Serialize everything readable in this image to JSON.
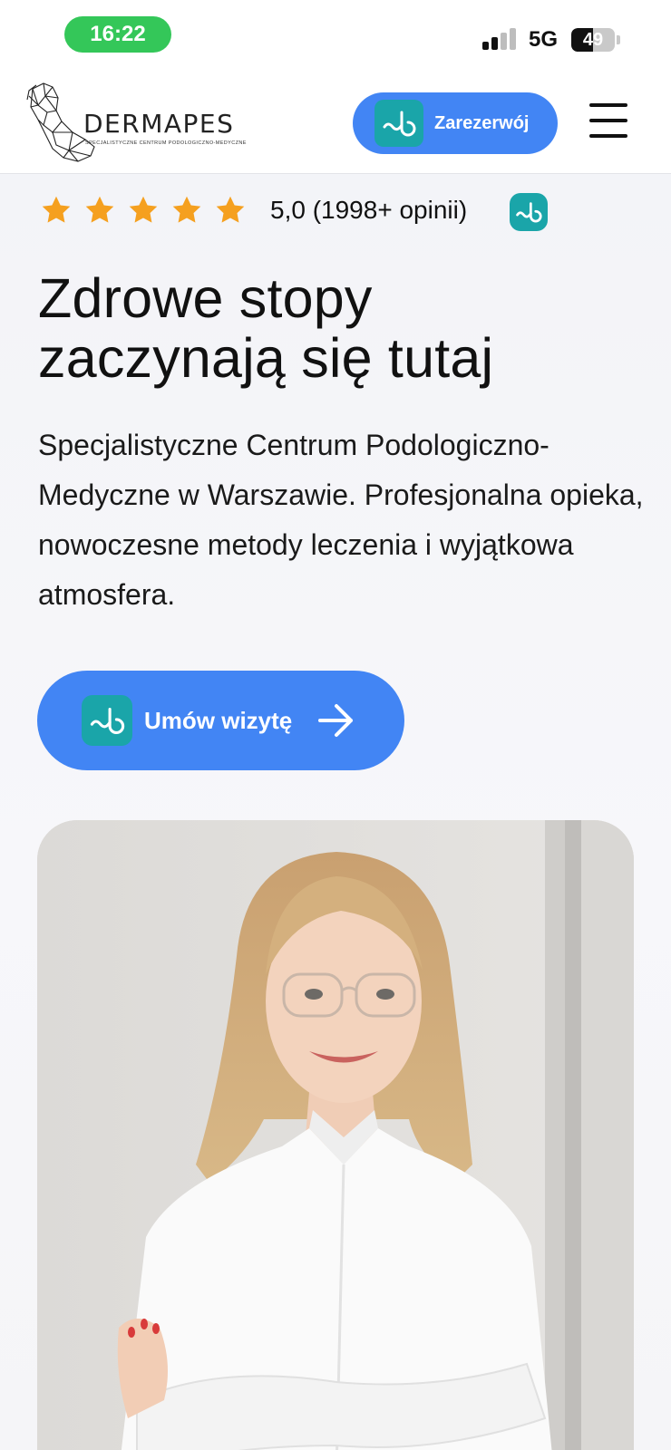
{
  "status_bar": {
    "time": "16:22",
    "network": "5G",
    "battery_level": "49",
    "battery_fraction": 0.49,
    "signal_bars_active": 2,
    "signal_bars_total": 4
  },
  "header": {
    "logo": {
      "name": "DERMAPES",
      "tagline": "SPECJALISTYCZNE CENTRUM PODOLOGICZNO-MEDYCZNE"
    },
    "reserve_button": {
      "label": "Zarezerwój",
      "icon": "booksy-icon"
    },
    "menu_icon": "hamburger-menu-icon"
  },
  "rating": {
    "stars": 5,
    "text": "5,0 (1998+ opinii)",
    "badge_icon": "booksy-icon"
  },
  "hero": {
    "title_line1": "Zdrowe stopy",
    "title_line2": "zaczynają się tutaj",
    "description": "Specjalistyczne Centrum Podologiczno-Medyczne w Warszawie. Profesjonalna opieka, nowoczesne metody leczenia i wyjątkowa atmosfera.",
    "cta": {
      "label": "Umów wizytę",
      "icon": "booksy-icon",
      "arrow_icon": "arrow-right-icon"
    }
  },
  "photo": {
    "subject": "specialist-portrait"
  },
  "colors": {
    "primary_blue": "#4285f4",
    "booksy_teal": "#1aa5a9",
    "star_orange": "#f5a01f",
    "status_green": "#34c759"
  }
}
